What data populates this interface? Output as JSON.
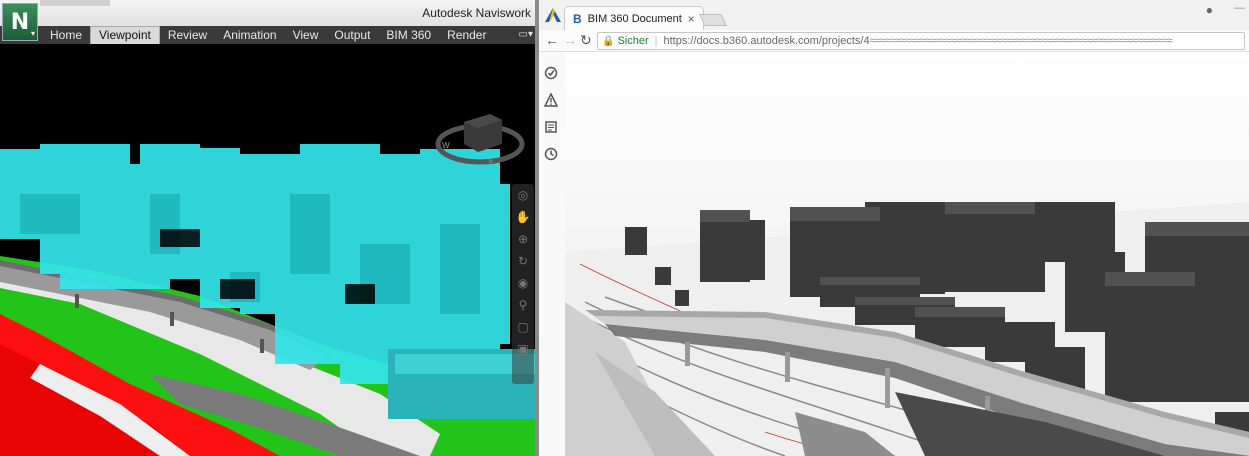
{
  "navisworks": {
    "app_title": "Autodesk Naviswork",
    "logo_letter": "N",
    "ribbon_tabs": [
      {
        "label": "Home"
      },
      {
        "label": "Viewpoint"
      },
      {
        "label": "Review"
      },
      {
        "label": "Animation"
      },
      {
        "label": "View"
      },
      {
        "label": "Output"
      },
      {
        "label": "BIM 360"
      },
      {
        "label": "Render"
      }
    ],
    "active_tab": "Viewpoint",
    "viewcube_labels": {
      "west": "W",
      "south": "S"
    },
    "colors": {
      "context_buildings": "#33e6ec",
      "road_surface": "#9a9a9a",
      "terrain_green": "#22c41a",
      "clash_red": "#ff1010",
      "background": "#000000"
    }
  },
  "browser": {
    "tab_title": "BIM 360 Document Mana",
    "tab_favicon": "B",
    "secure_label": "Sicher",
    "url": "https://docs.b360.autodesk.com/projects/4",
    "colors": {
      "buildings": "#3a3a3a",
      "bridge": "#c9c9c9",
      "background": "#f2f2f2"
    }
  },
  "sidebar_icons": [
    "checklist-icon",
    "warning-icon",
    "document-icon",
    "clock-icon"
  ]
}
